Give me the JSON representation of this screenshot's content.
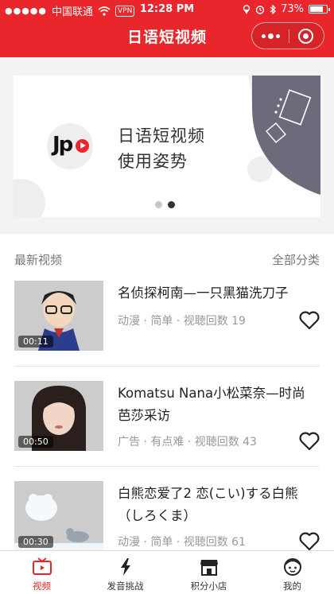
{
  "status_bar": {
    "carrier": "中国联通",
    "vpn": "VPN",
    "time": "12:28 PM",
    "battery": "73%"
  },
  "nav": {
    "title": "日语短视频"
  },
  "banner": {
    "logo_text": "Jp",
    "line1": "日语短视频",
    "line2": "使用姿势",
    "pages": 2,
    "active_page": 2
  },
  "section": {
    "title": "最新视频",
    "link": "全部分类"
  },
  "videos": [
    {
      "title": "名侦探柯南—一只黑猫洗刀子",
      "meta": "动漫 · 简单 · 视聴回数 19",
      "duration": "00:11"
    },
    {
      "title": "Komatsu Nana小松菜奈—时尚芭莎采访",
      "meta": "广告 · 有点难 · 视聴回数 43",
      "duration": "00:50"
    },
    {
      "title": "白熊恋爱了2 恋(こい)する白熊（しろくま）",
      "meta": "动漫 · 简单 · 视聴回数 61",
      "duration": "00:30"
    }
  ],
  "tabs": [
    {
      "label": "视频",
      "icon": "tv-icon",
      "active": true
    },
    {
      "label": "发音挑战",
      "icon": "lightning-icon",
      "active": false
    },
    {
      "label": "积分小店",
      "icon": "shop-icon",
      "active": false
    },
    {
      "label": "我的",
      "icon": "face-icon",
      "active": false
    }
  ],
  "colors": {
    "brand_red": "#e8262b",
    "text_dark": "#222222",
    "text_gray": "#999999"
  }
}
